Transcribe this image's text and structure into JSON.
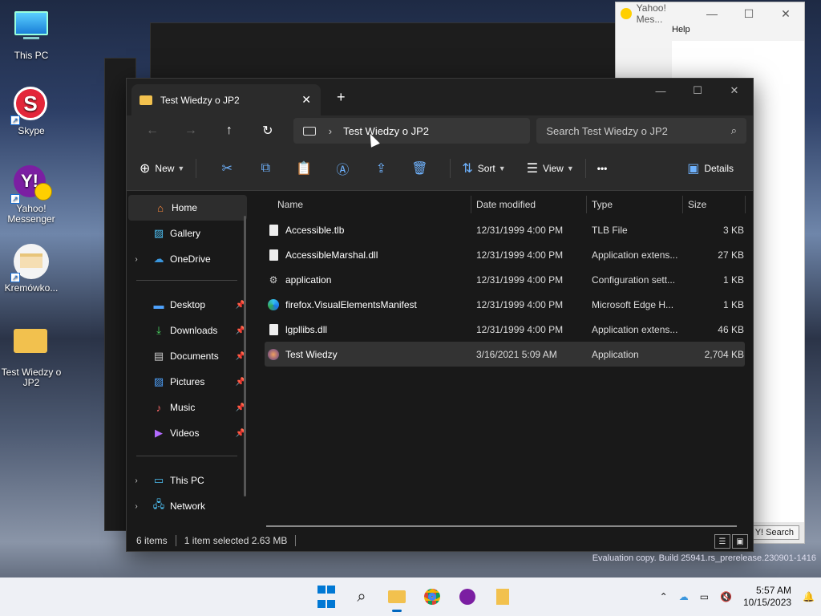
{
  "desktop": {
    "icons": [
      {
        "label": "This PC",
        "icon": "monitor-icon"
      },
      {
        "label": "Skype",
        "icon": "skype-icon"
      },
      {
        "label": "Yahoo! Messenger",
        "icon": "yahoo-icon"
      },
      {
        "label": "Kremówko...",
        "icon": "cake-icon"
      },
      {
        "label": "Test Wiedzy o JP2",
        "icon": "folder-icon"
      }
    ]
  },
  "yahoo_window": {
    "title": "Yahoo! Mes...",
    "menu": "Help",
    "search_btn": "Y! Search"
  },
  "explorer": {
    "tab_title": "Test Wiedzy o JP2",
    "breadcrumb": "Test Wiedzy o JP2",
    "search_placeholder": "Search Test Wiedzy o JP2",
    "toolbar": {
      "new_label": "New",
      "sort_label": "Sort",
      "view_label": "View",
      "more_label": "•••",
      "details_label": "Details"
    },
    "nav": {
      "home": "Home",
      "gallery": "Gallery",
      "onedrive": "OneDrive",
      "desktop": "Desktop",
      "downloads": "Downloads",
      "documents": "Documents",
      "pictures": "Pictures",
      "music": "Music",
      "videos": "Videos",
      "thispc": "This PC",
      "network": "Network"
    },
    "columns": {
      "name": "Name",
      "date": "Date modified",
      "type": "Type",
      "size": "Size"
    },
    "files": [
      {
        "name": "Accessible.tlb",
        "date": "12/31/1999 4:00 PM",
        "type": "TLB File",
        "size": "3 KB"
      },
      {
        "name": "AccessibleMarshal.dll",
        "date": "12/31/1999 4:00 PM",
        "type": "Application extens...",
        "size": "27 KB"
      },
      {
        "name": "application",
        "date": "12/31/1999 4:00 PM",
        "type": "Configuration sett...",
        "size": "1 KB"
      },
      {
        "name": "firefox.VisualElementsManifest",
        "date": "12/31/1999 4:00 PM",
        "type": "Microsoft Edge H...",
        "size": "1 KB"
      },
      {
        "name": "lgpllibs.dll",
        "date": "12/31/1999 4:00 PM",
        "type": "Application extens...",
        "size": "46 KB"
      },
      {
        "name": "Test Wiedzy",
        "date": "3/16/2021 5:09 AM",
        "type": "Application",
        "size": "2,704 KB"
      }
    ],
    "status": {
      "items": "6 items",
      "selected": "1 item selected  2.63 MB"
    }
  },
  "taskbar": {
    "time": "5:57 AM",
    "date": "10/15/2023",
    "watermark": "Evaluation copy. Build 25941.rs_prerelease.230901-1416"
  }
}
